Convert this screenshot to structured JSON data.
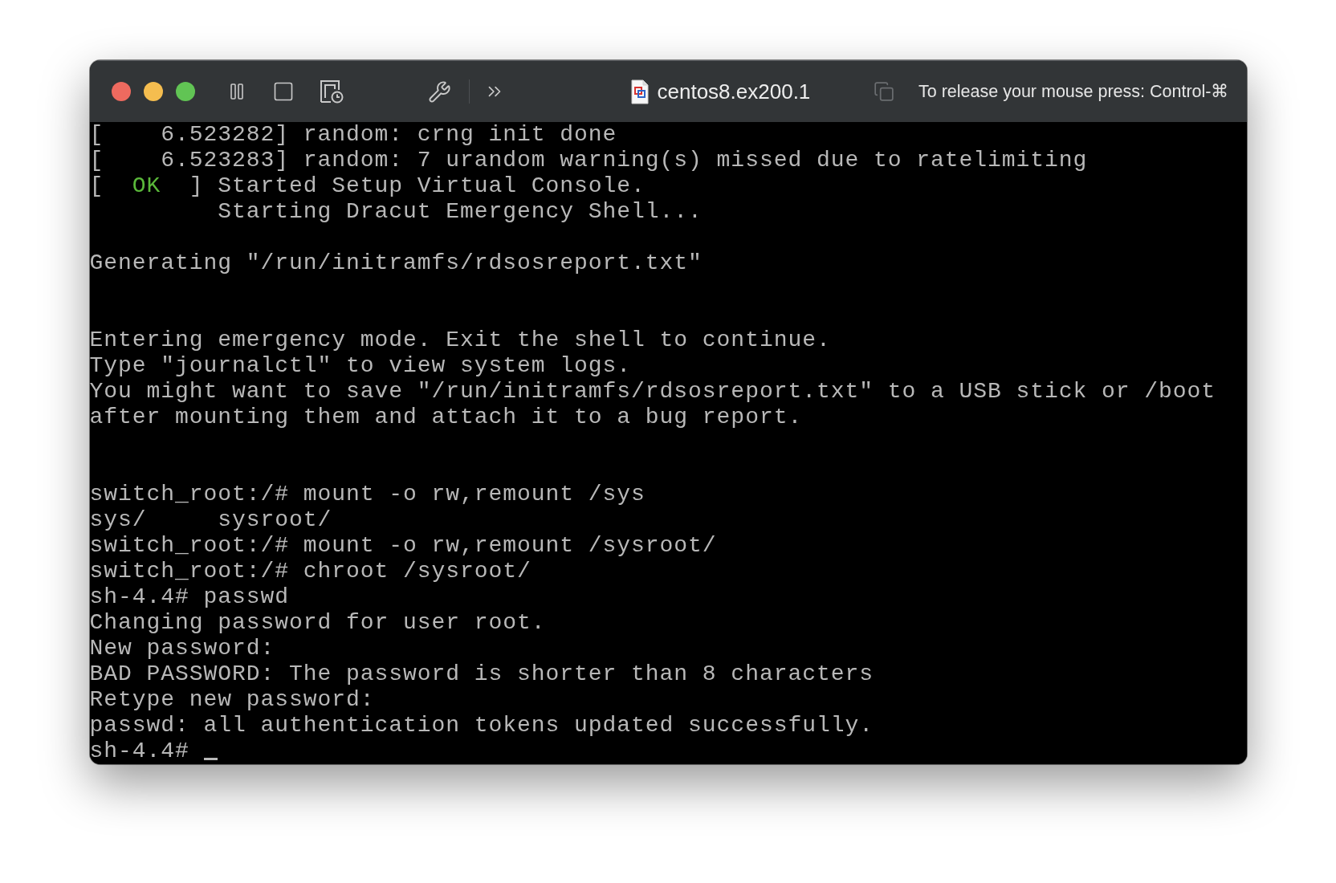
{
  "window": {
    "title": "centos8.ex200.1",
    "hint": "To release your mouse press: Control-⌘"
  },
  "terminal": {
    "lines": [
      {
        "kind": "text",
        "text": "[    6.523282] random: crng init done"
      },
      {
        "kind": "text",
        "text": "[    6.523283] random: 7 urandom warning(s) missed due to ratelimiting"
      },
      {
        "kind": "status",
        "before": "[  ",
        "status": "OK",
        "color": "#5ab83a",
        "after": "  ] Started Setup Virtual Console."
      },
      {
        "kind": "text",
        "text": "         Starting Dracut Emergency Shell..."
      },
      {
        "kind": "blank"
      },
      {
        "kind": "text",
        "text": "Generating \"/run/initramfs/rdsosreport.txt\""
      },
      {
        "kind": "blank"
      },
      {
        "kind": "blank"
      },
      {
        "kind": "text",
        "text": "Entering emergency mode. Exit the shell to continue."
      },
      {
        "kind": "text",
        "text": "Type \"journalctl\" to view system logs."
      },
      {
        "kind": "text",
        "text": "You might want to save \"/run/initramfs/rdsosreport.txt\" to a USB stick or /boot"
      },
      {
        "kind": "text",
        "text": "after mounting them and attach it to a bug report."
      },
      {
        "kind": "blank"
      },
      {
        "kind": "blank"
      },
      {
        "kind": "text",
        "text": "switch_root:/# mount -o rw,remount /sys"
      },
      {
        "kind": "text",
        "text": "sys/     sysroot/"
      },
      {
        "kind": "text",
        "text": "switch_root:/# mount -o rw,remount /sysroot/"
      },
      {
        "kind": "text",
        "text": "switch_root:/# chroot /sysroot/"
      },
      {
        "kind": "text",
        "text": "sh-4.4# passwd"
      },
      {
        "kind": "text",
        "text": "Changing password for user root."
      },
      {
        "kind": "text",
        "text": "New password:"
      },
      {
        "kind": "text",
        "text": "BAD PASSWORD: The password is shorter than 8 characters"
      },
      {
        "kind": "text",
        "text": "Retype new password:"
      },
      {
        "kind": "text",
        "text": "passwd: all authentication tokens updated successfully."
      },
      {
        "kind": "prompt",
        "text": "sh-4.4#",
        "cursor": true
      }
    ]
  }
}
